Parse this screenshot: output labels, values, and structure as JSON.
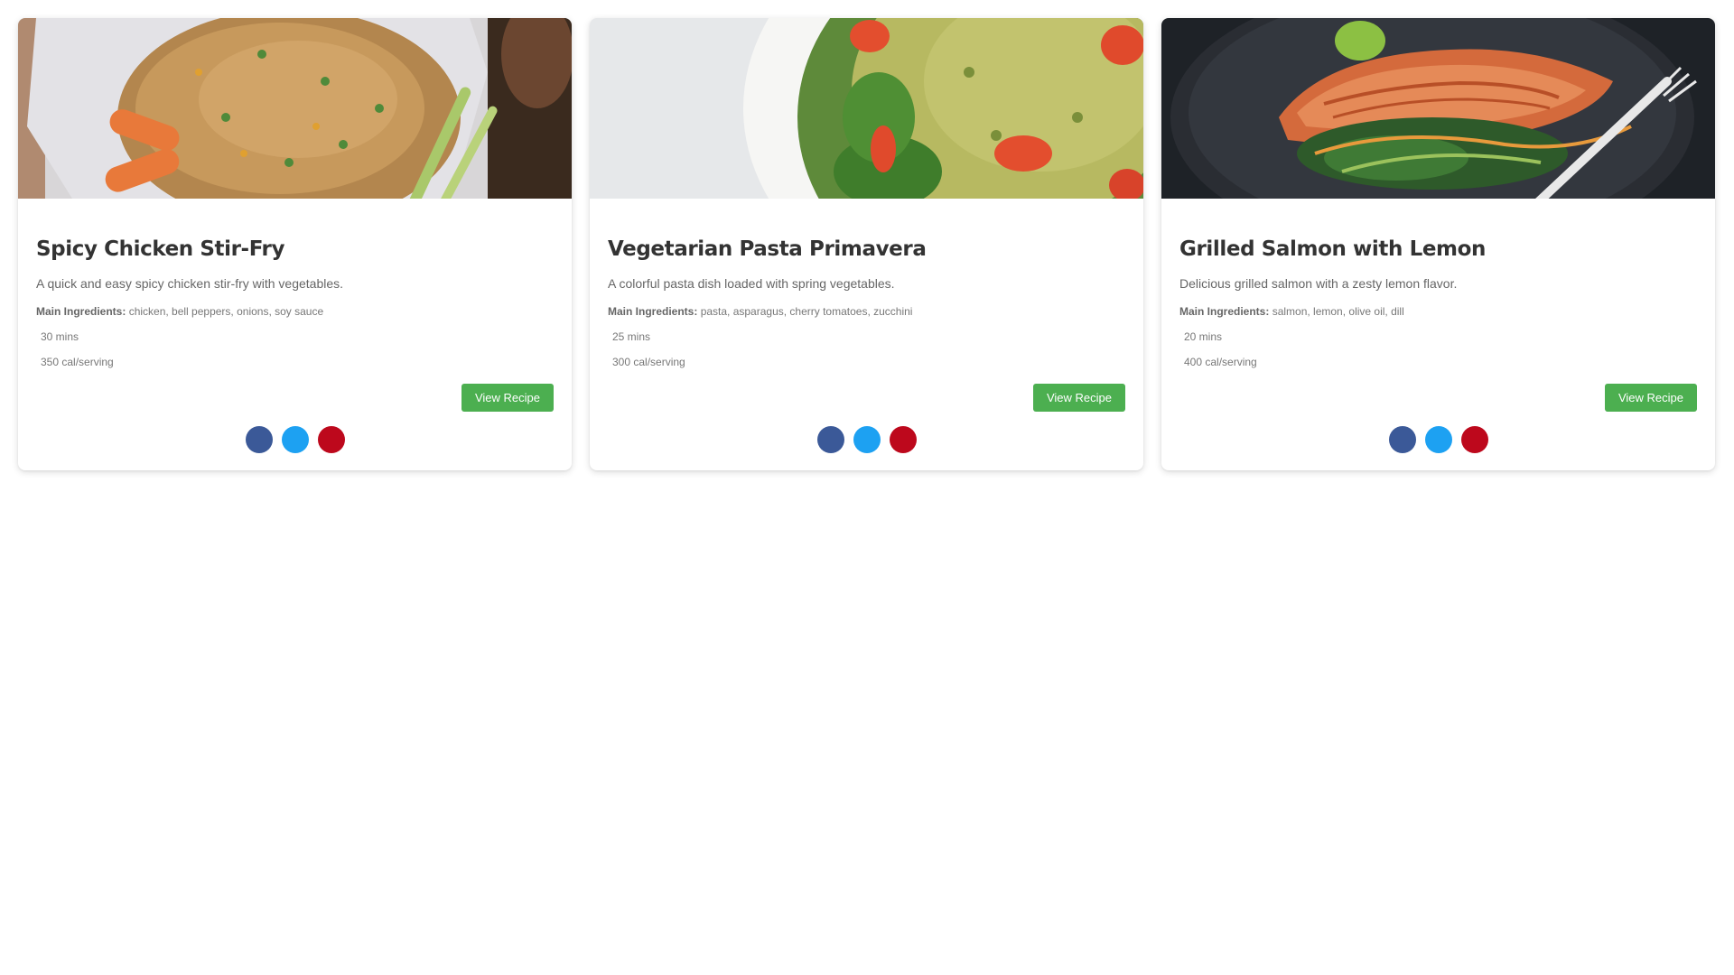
{
  "cards": [
    {
      "title": "Spicy Chicken Stir-Fry",
      "description": "A quick and easy spicy chicken stir-fry with vegetables.",
      "ingredients_label": "Main Ingredients:",
      "ingredients": "chicken, bell peppers, onions, soy sauce",
      "time": "30 mins",
      "calories": "350 cal/serving",
      "button_label": "View Recipe",
      "image_icon": "fried-rice-photo"
    },
    {
      "title": "Vegetarian Pasta Primavera",
      "description": "A colorful pasta dish loaded with spring vegetables.",
      "ingredients_label": "Main Ingredients:",
      "ingredients": "pasta, asparagus, cherry tomatoes, zucchini",
      "time": "25 mins",
      "calories": "300 cal/serving",
      "button_label": "View Recipe",
      "image_icon": "pesto-pasta-photo"
    },
    {
      "title": "Grilled Salmon with Lemon",
      "description": "Delicious grilled salmon with a zesty lemon flavor.",
      "ingredients_label": "Main Ingredients:",
      "ingredients": "salmon, lemon, olive oil, dill",
      "time": "20 mins",
      "calories": "400 cal/serving",
      "button_label": "View Recipe",
      "image_icon": "grilled-salmon-photo"
    }
  ],
  "share_icons": [
    "facebook-icon",
    "twitter-icon",
    "pinterest-icon"
  ],
  "colors": {
    "button": "#4caf50",
    "facebook": "#3b5998",
    "twitter": "#1da1f2",
    "pinterest": "#bd081c",
    "title": "#333333",
    "text": "#666666"
  }
}
